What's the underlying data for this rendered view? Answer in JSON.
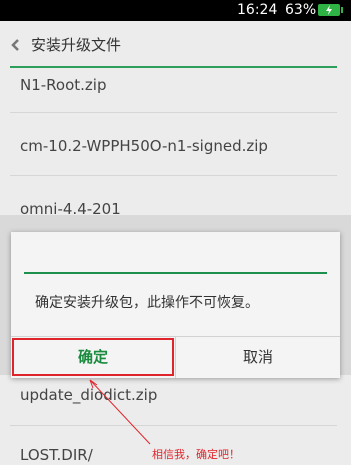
{
  "status_bar": {
    "time": "16:24",
    "battery_percent": "63%"
  },
  "header": {
    "title": "安装升级文件"
  },
  "files": [
    "N1-Root.zip",
    "cm-10.2-WPPH50O-n1-signed.zip",
    "omni-4.4-201",
    "update_diodict.zip",
    "LOST.DIR/"
  ],
  "dialog": {
    "message": "确定安装升级包，此操作不可恢复。",
    "confirm_label": "确定",
    "cancel_label": "取消"
  },
  "annotation": {
    "text": "相信我，确定吧！",
    "color": "#e0242b"
  },
  "colors": {
    "accent": "#2e9e5b",
    "confirm_text": "#1a8a3e"
  }
}
